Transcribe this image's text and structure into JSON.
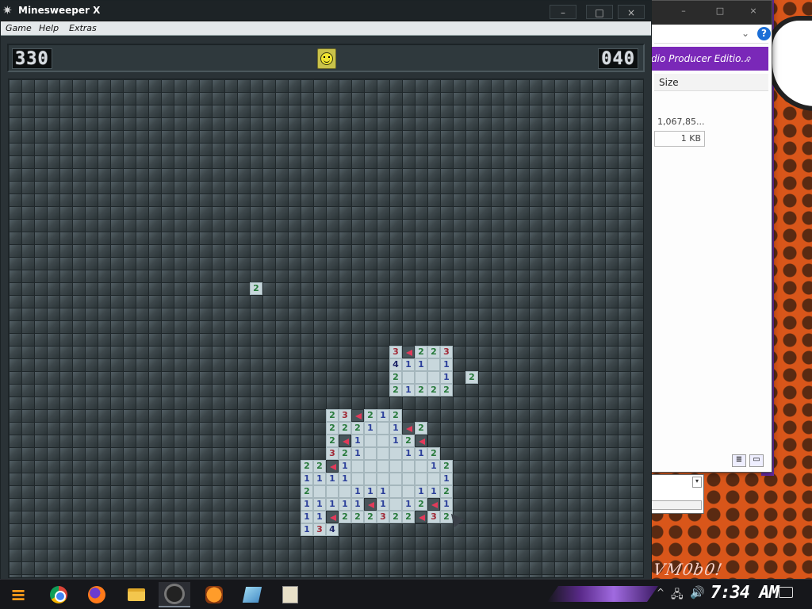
{
  "minesweeper": {
    "title": "Minesweeper X",
    "menu": [
      "Game",
      "Help",
      "Extras"
    ],
    "window_controls": {
      "minimize": "–",
      "maximize": "□",
      "close": "×"
    },
    "mine_counter": "330",
    "timer": "040",
    "board": {
      "cell_size": 16,
      "columns": 50,
      "revealed": [
        {
          "col": 19,
          "row": 16,
          "v": "2"
        },
        {
          "col": 30,
          "row": 21,
          "v": "3"
        },
        {
          "col": 31,
          "row": 21,
          "v": "F"
        },
        {
          "col": 32,
          "row": 21,
          "v": "2"
        },
        {
          "col": 33,
          "row": 21,
          "v": "2"
        },
        {
          "col": 34,
          "row": 21,
          "v": "3"
        },
        {
          "col": 30,
          "row": 22,
          "v": "4"
        },
        {
          "col": 31,
          "row": 22,
          "v": "1"
        },
        {
          "col": 32,
          "row": 22,
          "v": "1"
        },
        {
          "col": 33,
          "row": 22,
          "v": ""
        },
        {
          "col": 34,
          "row": 22,
          "v": "1"
        },
        {
          "col": 30,
          "row": 23,
          "v": "2"
        },
        {
          "col": 31,
          "row": 23,
          "v": ""
        },
        {
          "col": 32,
          "row": 23,
          "v": ""
        },
        {
          "col": 33,
          "row": 23,
          "v": ""
        },
        {
          "col": 34,
          "row": 23,
          "v": "1"
        },
        {
          "col": 36,
          "row": 23,
          "v": "2"
        },
        {
          "col": 30,
          "row": 24,
          "v": "2"
        },
        {
          "col": 31,
          "row": 24,
          "v": "1"
        },
        {
          "col": 32,
          "row": 24,
          "v": "2"
        },
        {
          "col": 33,
          "row": 24,
          "v": "2"
        },
        {
          "col": 34,
          "row": 24,
          "v": "2"
        },
        {
          "col": 25,
          "row": 26,
          "v": "2"
        },
        {
          "col": 26,
          "row": 26,
          "v": "3"
        },
        {
          "col": 27,
          "row": 26,
          "v": "F"
        },
        {
          "col": 28,
          "row": 26,
          "v": "2"
        },
        {
          "col": 29,
          "row": 26,
          "v": "1"
        },
        {
          "col": 30,
          "row": 26,
          "v": "2"
        },
        {
          "col": 25,
          "row": 27,
          "v": "2"
        },
        {
          "col": 26,
          "row": 27,
          "v": "2"
        },
        {
          "col": 27,
          "row": 27,
          "v": "2"
        },
        {
          "col": 28,
          "row": 27,
          "v": "1"
        },
        {
          "col": 29,
          "row": 27,
          "v": ""
        },
        {
          "col": 30,
          "row": 27,
          "v": "1"
        },
        {
          "col": 31,
          "row": 27,
          "v": "F"
        },
        {
          "col": 32,
          "row": 27,
          "v": "2"
        },
        {
          "col": 25,
          "row": 28,
          "v": "2"
        },
        {
          "col": 26,
          "row": 28,
          "v": "F"
        },
        {
          "col": 27,
          "row": 28,
          "v": "1"
        },
        {
          "col": 28,
          "row": 28,
          "v": ""
        },
        {
          "col": 29,
          "row": 28,
          "v": ""
        },
        {
          "col": 30,
          "row": 28,
          "v": "1"
        },
        {
          "col": 31,
          "row": 28,
          "v": "2"
        },
        {
          "col": 32,
          "row": 28,
          "v": "F"
        },
        {
          "col": 25,
          "row": 29,
          "v": "3"
        },
        {
          "col": 26,
          "row": 29,
          "v": "2"
        },
        {
          "col": 27,
          "row": 29,
          "v": "1"
        },
        {
          "col": 28,
          "row": 29,
          "v": ""
        },
        {
          "col": 29,
          "row": 29,
          "v": ""
        },
        {
          "col": 30,
          "row": 29,
          "v": ""
        },
        {
          "col": 31,
          "row": 29,
          "v": "1"
        },
        {
          "col": 32,
          "row": 29,
          "v": "1"
        },
        {
          "col": 33,
          "row": 29,
          "v": "2"
        },
        {
          "col": 23,
          "row": 30,
          "v": "2"
        },
        {
          "col": 24,
          "row": 30,
          "v": "2"
        },
        {
          "col": 25,
          "row": 30,
          "v": "F"
        },
        {
          "col": 26,
          "row": 30,
          "v": "1"
        },
        {
          "col": 27,
          "row": 30,
          "v": ""
        },
        {
          "col": 28,
          "row": 30,
          "v": ""
        },
        {
          "col": 29,
          "row": 30,
          "v": ""
        },
        {
          "col": 30,
          "row": 30,
          "v": ""
        },
        {
          "col": 31,
          "row": 30,
          "v": ""
        },
        {
          "col": 32,
          "row": 30,
          "v": ""
        },
        {
          "col": 33,
          "row": 30,
          "v": "1"
        },
        {
          "col": 34,
          "row": 30,
          "v": "2"
        },
        {
          "col": 23,
          "row": 31,
          "v": "1"
        },
        {
          "col": 24,
          "row": 31,
          "v": "1"
        },
        {
          "col": 25,
          "row": 31,
          "v": "1"
        },
        {
          "col": 26,
          "row": 31,
          "v": "1"
        },
        {
          "col": 27,
          "row": 31,
          "v": ""
        },
        {
          "col": 28,
          "row": 31,
          "v": ""
        },
        {
          "col": 29,
          "row": 31,
          "v": ""
        },
        {
          "col": 30,
          "row": 31,
          "v": ""
        },
        {
          "col": 31,
          "row": 31,
          "v": ""
        },
        {
          "col": 32,
          "row": 31,
          "v": ""
        },
        {
          "col": 33,
          "row": 31,
          "v": ""
        },
        {
          "col": 34,
          "row": 31,
          "v": "1"
        },
        {
          "col": 23,
          "row": 32,
          "v": "2"
        },
        {
          "col": 24,
          "row": 32,
          "v": ""
        },
        {
          "col": 25,
          "row": 32,
          "v": ""
        },
        {
          "col": 26,
          "row": 32,
          "v": ""
        },
        {
          "col": 27,
          "row": 32,
          "v": "1"
        },
        {
          "col": 28,
          "row": 32,
          "v": "1"
        },
        {
          "col": 29,
          "row": 32,
          "v": "1"
        },
        {
          "col": 30,
          "row": 32,
          "v": ""
        },
        {
          "col": 31,
          "row": 32,
          "v": ""
        },
        {
          "col": 32,
          "row": 32,
          "v": "1"
        },
        {
          "col": 33,
          "row": 32,
          "v": "1"
        },
        {
          "col": 34,
          "row": 32,
          "v": "2"
        },
        {
          "col": 23,
          "row": 33,
          "v": "1"
        },
        {
          "col": 24,
          "row": 33,
          "v": "1"
        },
        {
          "col": 25,
          "row": 33,
          "v": "1"
        },
        {
          "col": 26,
          "row": 33,
          "v": "1"
        },
        {
          "col": 27,
          "row": 33,
          "v": "1"
        },
        {
          "col": 28,
          "row": 33,
          "v": "F"
        },
        {
          "col": 29,
          "row": 33,
          "v": "1"
        },
        {
          "col": 30,
          "row": 33,
          "v": ""
        },
        {
          "col": 31,
          "row": 33,
          "v": "1"
        },
        {
          "col": 32,
          "row": 33,
          "v": "2"
        },
        {
          "col": 33,
          "row": 33,
          "v": "F"
        },
        {
          "col": 34,
          "row": 33,
          "v": "1"
        },
        {
          "col": 23,
          "row": 34,
          "v": "1"
        },
        {
          "col": 24,
          "row": 34,
          "v": "1"
        },
        {
          "col": 25,
          "row": 34,
          "v": "F"
        },
        {
          "col": 26,
          "row": 34,
          "v": "2"
        },
        {
          "col": 27,
          "row": 34,
          "v": "2"
        },
        {
          "col": 28,
          "row": 34,
          "v": "2"
        },
        {
          "col": 29,
          "row": 34,
          "v": "3"
        },
        {
          "col": 30,
          "row": 34,
          "v": "2"
        },
        {
          "col": 31,
          "row": 34,
          "v": "2"
        },
        {
          "col": 32,
          "row": 34,
          "v": "F"
        },
        {
          "col": 33,
          "row": 34,
          "v": "3"
        },
        {
          "col": 34,
          "row": 34,
          "v": "2"
        },
        {
          "col": 23,
          "row": 35,
          "v": "1"
        },
        {
          "col": 24,
          "row": 35,
          "v": "3"
        },
        {
          "col": 25,
          "row": 35,
          "v": "4"
        }
      ]
    }
  },
  "explorer": {
    "search_text": "dio Producer Editio...",
    "column_header": "Size",
    "size_1": "1,067,85...",
    "size_2": "1 KB",
    "help": "?",
    "chevron": "⌄"
  },
  "desktop": {
    "wallpaper_text": "VM0b0!"
  },
  "taskbar": {
    "start_glyph": "≡",
    "apps": [
      "chrome-icon",
      "firefox-icon",
      "file-explorer-icon",
      "minesweeper-icon",
      "fl-studio-icon",
      "notepad-icon",
      "installer-icon"
    ],
    "tray_chevron": "^",
    "network": "🖧",
    "volume": "🔊",
    "clock": "7:34 AM"
  },
  "colors": {
    "n1": "#2b3f9a",
    "n2": "#277a3b",
    "n3": "#a02835",
    "n4": "#1d2466",
    "flag": "#e23a5a"
  }
}
